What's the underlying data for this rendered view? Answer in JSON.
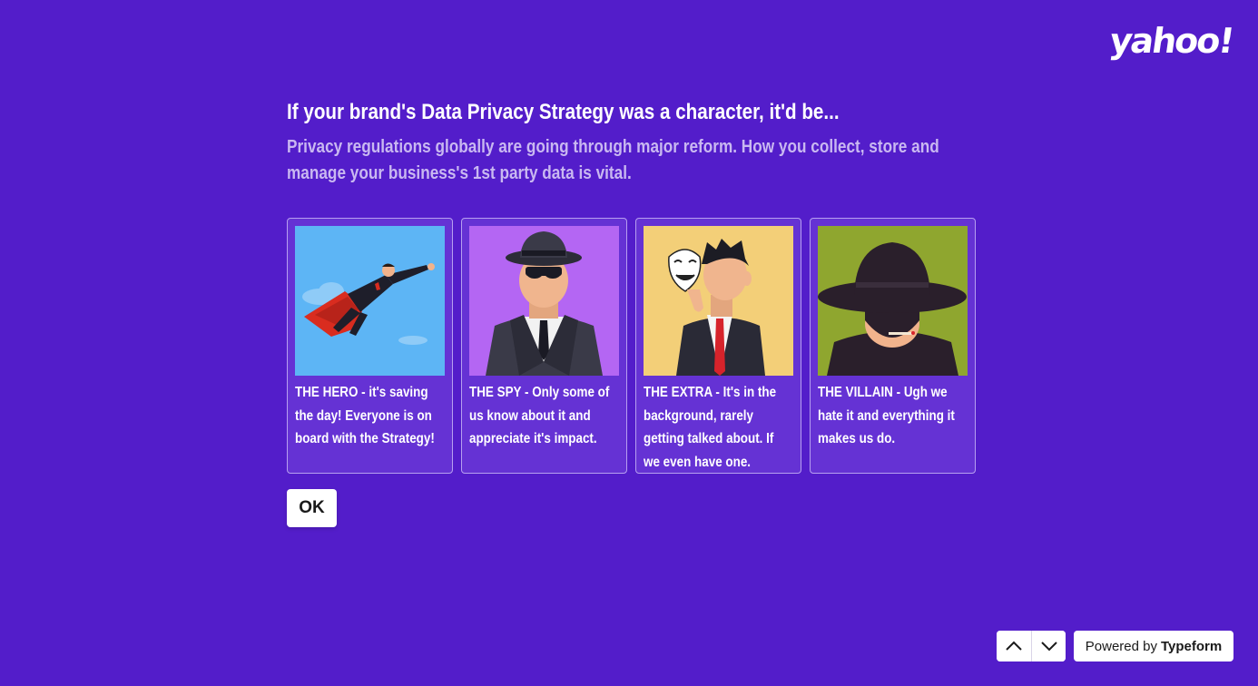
{
  "brand": {
    "logo_text": "yahoo!"
  },
  "question": {
    "title": "If your brand's Data Privacy Strategy was a character, it'd be...",
    "description": "Privacy regulations globally are going through major reform. How you collect, store and manage your business's 1st party data is vital."
  },
  "choices": [
    {
      "label": "THE HERO - it's saving the day! Everyone is on board with the Strategy!",
      "image_bg": "#5db5f5"
    },
    {
      "label": "THE SPY - Only some of us know about it and appreciate it's impact.",
      "image_bg": "#b466f3"
    },
    {
      "label": "THE EXTRA - It's in the background, rarely getting talked about. If we even have one.",
      "image_bg": "#f3cf78"
    },
    {
      "label": "THE VILLAIN - Ugh we hate it and everything it makes us do.",
      "image_bg": "#8fa62f"
    }
  ],
  "ok_label": "OK",
  "footer": {
    "powered_prefix": "Powered by",
    "powered_brand": "Typeform",
    "nav_up_icon": "chevron-up-icon",
    "nav_down_icon": "chevron-down-icon"
  },
  "colors": {
    "background": "#531dca",
    "choice_bg": "#6532d4",
    "description": "#c9b8f1"
  }
}
